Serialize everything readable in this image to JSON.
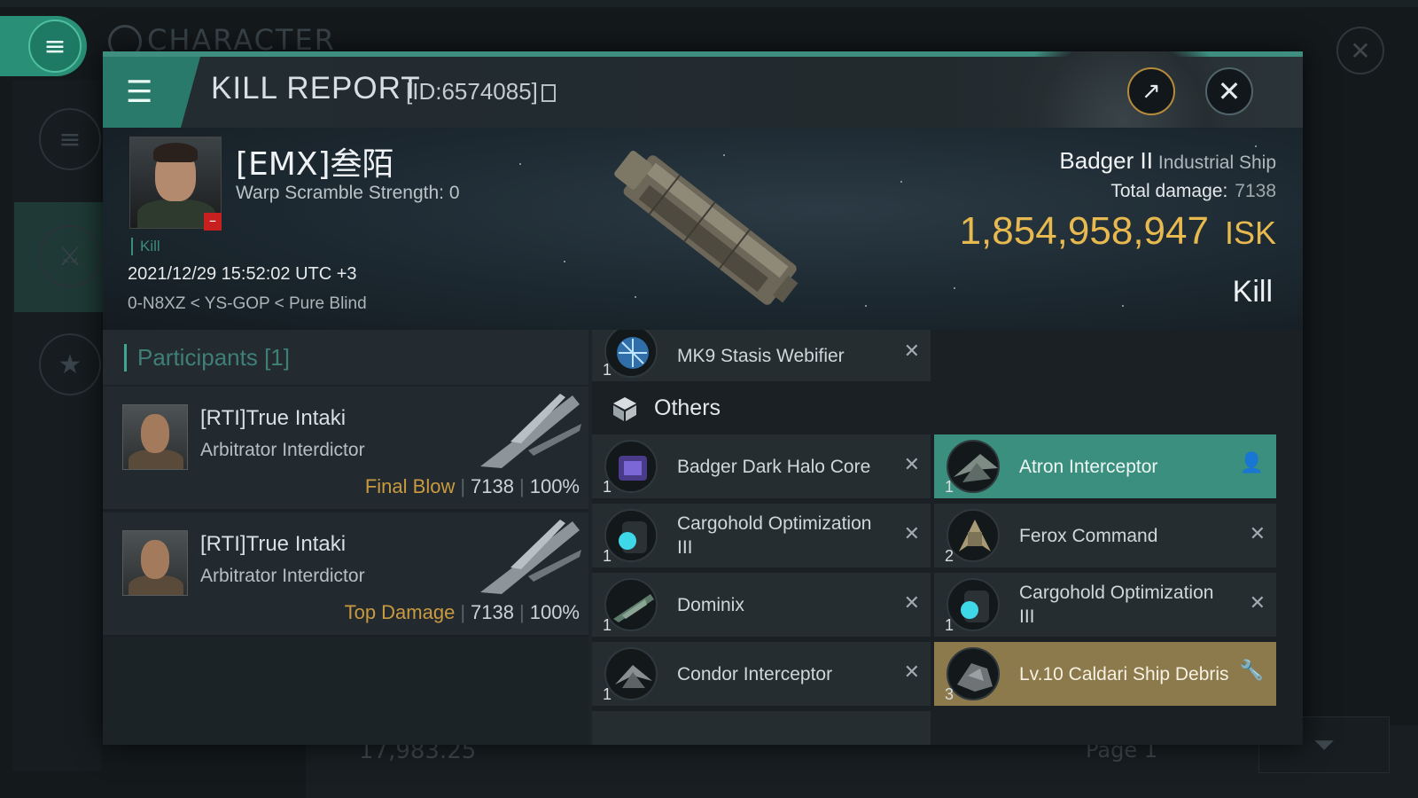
{
  "background": {
    "title": "CHARACTER",
    "bottom_value": "17,983.25",
    "bottom_page": "Page 1"
  },
  "header": {
    "title": "KILL REPORT",
    "report_id": "[ID:6574085]"
  },
  "victim": {
    "name": "[EMX]叁陌",
    "warp_scramble": "Warp Scramble Strength: 0",
    "tag": "Kill",
    "datetime": "2021/12/29 15:52:02 UTC +3",
    "location": "0-N8XZ < YS-GOP < Pure Blind",
    "ship_name": "Badger II",
    "ship_class": "Industrial Ship",
    "total_damage_label": "Total damage:",
    "total_damage": "7138",
    "isk_value": "1,854,958,947",
    "isk_unit": "ISK",
    "result": "Kill"
  },
  "participants": {
    "title": "Participants [1]",
    "rows": [
      {
        "name": "[RTI]True Intaki",
        "ship": "Arbitrator Interdictor",
        "label": "Final Blow",
        "damage": "7138",
        "percent": "100%"
      },
      {
        "name": "[RTI]True Intaki",
        "ship": "Arbitrator Interdictor",
        "label": "Top Damage",
        "damage": "7138",
        "percent": "100%"
      }
    ]
  },
  "items": {
    "top_item": {
      "name": "MK9 Stasis Webifier",
      "qty": "1"
    },
    "others_title": "Others",
    "left": [
      {
        "name": "Badger Dark Halo Core",
        "qty": "1"
      },
      {
        "name": "Cargohold Optimization III",
        "qty": "1"
      },
      {
        "name": "Dominix",
        "qty": "1"
      },
      {
        "name": "Condor Interceptor",
        "qty": "1"
      }
    ],
    "right": [
      {
        "name": "Atron Interceptor",
        "qty": "1"
      },
      {
        "name": "Ferox Command",
        "qty": "2"
      },
      {
        "name": "Cargohold Optimization III",
        "qty": "1"
      },
      {
        "name": "Lv.10 Caldari Ship Debris",
        "qty": "3"
      }
    ]
  },
  "colors": {
    "accent_teal": "#3a8f7e",
    "isk_gold": "#e8b94f",
    "highlight_gold": "#8c7a4c"
  }
}
